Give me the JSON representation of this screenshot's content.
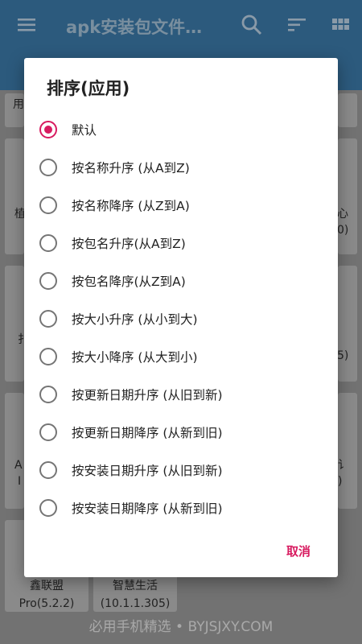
{
  "appbar": {
    "title": "apk安装包文件…"
  },
  "background": {
    "partial_labels": [
      "用",
      "植",
      "心",
      "0)",
      "扌",
      "5)",
      "A",
      "I",
      "讠",
      ")"
    ],
    "cards": [
      {
        "name": "鑫联盟",
        "version": "Pro(5.2.2)"
      },
      {
        "name": "智慧生活",
        "version": "(10.1.1.305)"
      }
    ]
  },
  "dialog": {
    "title": "排序(应用)",
    "options": [
      {
        "label": "默认",
        "selected": true
      },
      {
        "label": "按名称升序 (从A到Z)",
        "selected": false
      },
      {
        "label": "按名称降序 (从Z到A)",
        "selected": false
      },
      {
        "label": "按包名升序(从A到Z)",
        "selected": false
      },
      {
        "label": "按包名降序(从Z到A)",
        "selected": false
      },
      {
        "label": "按大小升序 (从小到大)",
        "selected": false
      },
      {
        "label": "按大小降序 (从大到小)",
        "selected": false
      },
      {
        "label": "按更新日期升序 (从旧到新)",
        "selected": false
      },
      {
        "label": "按更新日期降序 (从新到旧)",
        "selected": false
      },
      {
        "label": "按安装日期升序 (从旧到新)",
        "selected": false
      },
      {
        "label": "按安装日期降序 (从新到旧)",
        "selected": false
      }
    ],
    "cancel_label": "取消"
  },
  "watermark": "必用手机精选 • BYJSJXY.COM",
  "colors": {
    "accent": "#d81b60",
    "appbar": "#2c5a7d"
  }
}
